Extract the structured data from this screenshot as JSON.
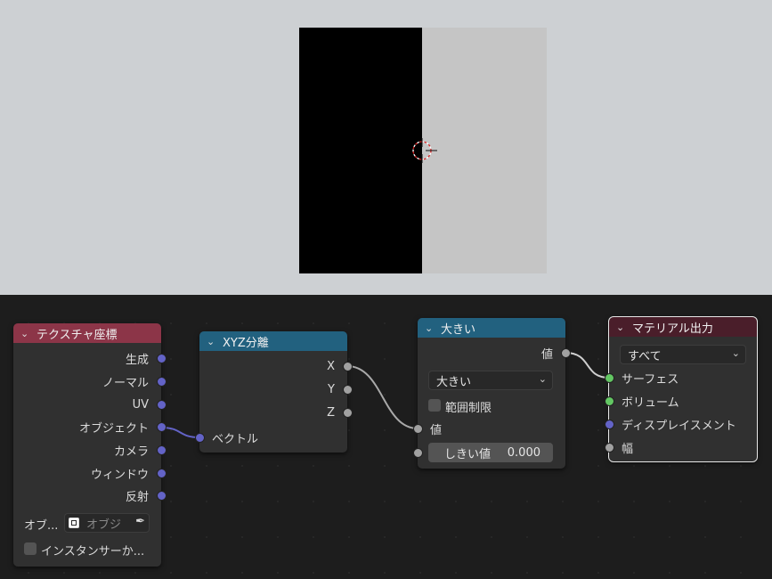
{
  "colors": {
    "texcoord_header": "#8c3548",
    "converter_header": "#22617f",
    "output_header": "#4a1e2a",
    "vector_socket": "#6363c7",
    "float_socket": "#a1a1a1",
    "shader_socket": "#63c763"
  },
  "texture_coordinate": {
    "title": "テクスチャ座標",
    "outputs": [
      "生成",
      "ノーマル",
      "UV",
      "オブジェクト",
      "カメラ",
      "ウィンドウ",
      "反射"
    ],
    "object_label": "オブ...",
    "object_placeholder": "オブジ",
    "instancer_label": "インスタンサーか..."
  },
  "separate_xyz": {
    "title": "XYZ分離",
    "outputs": [
      "X",
      "Y",
      "Z"
    ],
    "input": "ベクトル"
  },
  "math": {
    "title": "大きい",
    "output": "値",
    "operation": "大きい",
    "clamp_label": "範囲制限",
    "value_input": "値",
    "threshold_label": "しきい値",
    "threshold_value": "0.000"
  },
  "material_output": {
    "title": "マテリアル出力",
    "target": "すべて",
    "inputs": [
      "サーフェス",
      "ボリューム",
      "ディスプレイスメント",
      "幅"
    ]
  }
}
